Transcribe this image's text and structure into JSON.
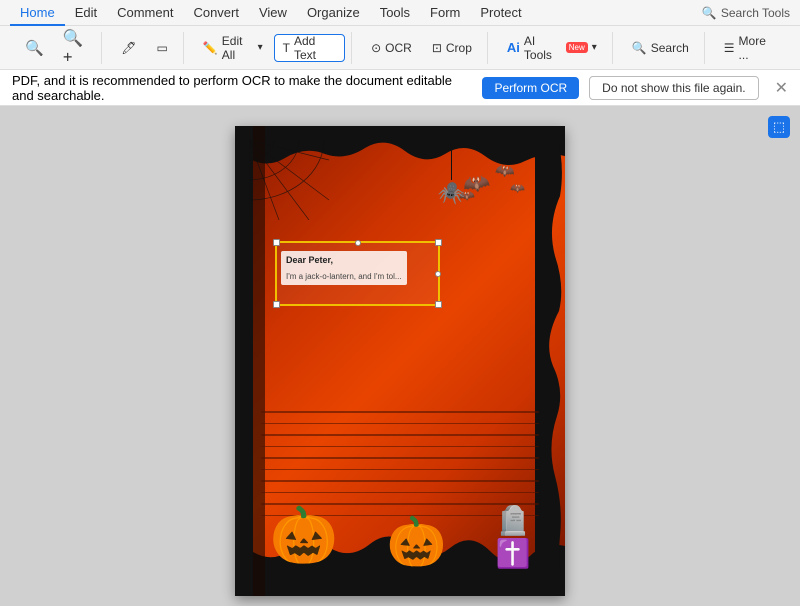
{
  "menubar": {
    "items": [
      {
        "label": "Home",
        "active": true
      },
      {
        "label": "Edit"
      },
      {
        "label": "Comment"
      },
      {
        "label": "Convert"
      },
      {
        "label": "View"
      },
      {
        "label": "Organize"
      },
      {
        "label": "Tools"
      },
      {
        "label": "Form"
      },
      {
        "label": "Protect"
      }
    ],
    "search_tools_icon": "🔍",
    "search_tools_label": "Search Tools"
  },
  "toolbar": {
    "zoom_out_icon": "🔍",
    "zoom_in_icon": "🔍",
    "highlight_icon": "🖊",
    "rect_icon": "▭",
    "edit_all_label": "Edit All",
    "add_text_label": "Add Text",
    "ocr_label": "OCR",
    "crop_label": "Crop",
    "ai_tools_label": "AI Tools",
    "search_label": "Search",
    "more_label": "More ..."
  },
  "notification": {
    "text": "PDF, and it is recommended to perform OCR to make the document editable and searchable.",
    "perform_ocr_label": "Perform OCR",
    "dont_show_label": "Do not show this file again.",
    "close_icon": "✕"
  },
  "document": {
    "text_line1": "Dear Peter,",
    "text_line2": "I'm a jack-o-lantern, and I'm tol..."
  },
  "panel_icon": "⬚"
}
